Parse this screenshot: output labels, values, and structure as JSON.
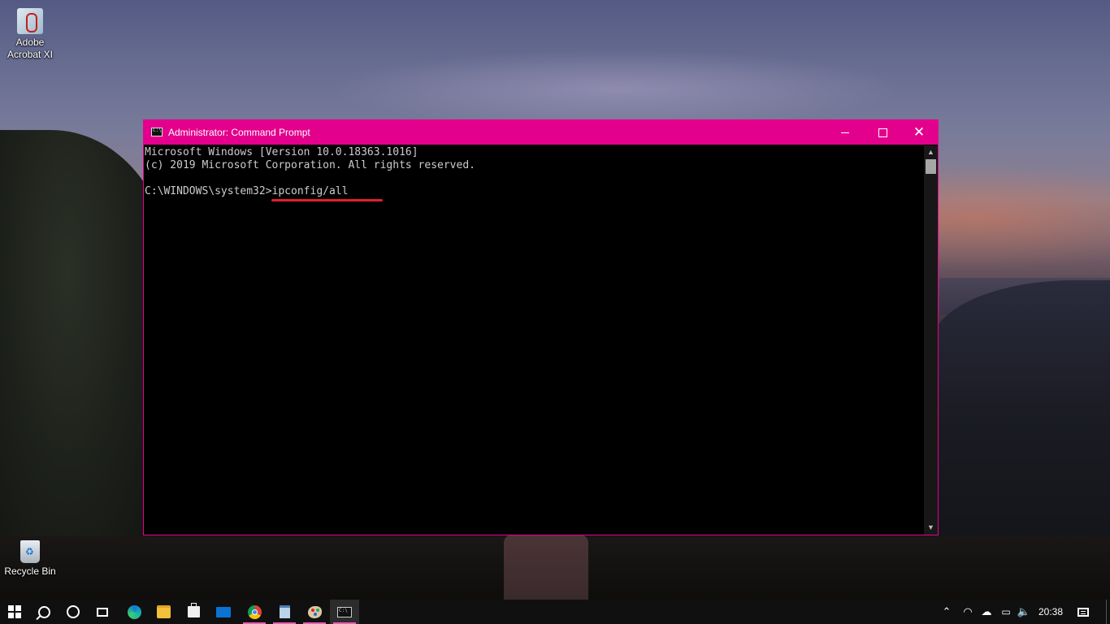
{
  "desktop": {
    "icons": [
      {
        "label": "Adobe Acrobat XI",
        "icon": "adobe-acrobat-icon"
      },
      {
        "label": "Recycle Bin",
        "icon": "recycle-bin-icon"
      }
    ]
  },
  "window": {
    "title": "Administrator: Command Prompt",
    "controls": {
      "minimize": "—",
      "maximize": "☐",
      "close": "✕"
    },
    "accent_color": "#e3008c",
    "console_lines": [
      "Microsoft Windows [Version 10.0.18363.1016]",
      "(c) 2019 Microsoft Corporation. All rights reserved.",
      "",
      "C:\\WINDOWS\\system32>ipconfig/all"
    ],
    "annotation_color": "#e0202a"
  },
  "taskbar": {
    "items": [
      {
        "name": "start",
        "icon": "windows-logo-icon"
      },
      {
        "name": "search",
        "icon": "search-icon"
      },
      {
        "name": "cortana",
        "icon": "cortana-icon"
      },
      {
        "name": "task-view",
        "icon": "task-view-icon"
      },
      {
        "name": "edge",
        "icon": "edge-icon"
      },
      {
        "name": "file-explorer",
        "icon": "folder-icon"
      },
      {
        "name": "store",
        "icon": "store-icon"
      },
      {
        "name": "mail",
        "icon": "mail-icon"
      },
      {
        "name": "chrome",
        "icon": "chrome-icon"
      },
      {
        "name": "notepad",
        "icon": "notepad-icon"
      },
      {
        "name": "paint",
        "icon": "paint-icon"
      },
      {
        "name": "command-prompt",
        "icon": "command-prompt-icon"
      }
    ],
    "tray": {
      "chevron": "⌃",
      "clock": "20:38"
    }
  }
}
